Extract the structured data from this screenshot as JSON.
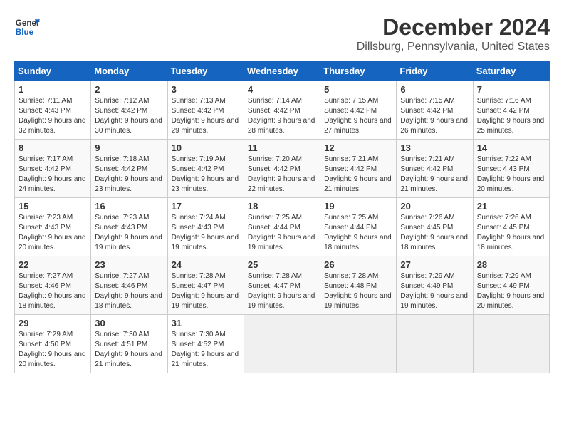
{
  "logo": {
    "line1": "General",
    "line2": "Blue"
  },
  "title": "December 2024",
  "subtitle": "Dillsburg, Pennsylvania, United States",
  "headers": [
    "Sunday",
    "Monday",
    "Tuesday",
    "Wednesday",
    "Thursday",
    "Friday",
    "Saturday"
  ],
  "weeks": [
    [
      {
        "day": "1",
        "sunrise": "7:11 AM",
        "sunset": "4:43 PM",
        "daylight": "9 hours and 32 minutes."
      },
      {
        "day": "2",
        "sunrise": "7:12 AM",
        "sunset": "4:42 PM",
        "daylight": "9 hours and 30 minutes."
      },
      {
        "day": "3",
        "sunrise": "7:13 AM",
        "sunset": "4:42 PM",
        "daylight": "9 hours and 29 minutes."
      },
      {
        "day": "4",
        "sunrise": "7:14 AM",
        "sunset": "4:42 PM",
        "daylight": "9 hours and 28 minutes."
      },
      {
        "day": "5",
        "sunrise": "7:15 AM",
        "sunset": "4:42 PM",
        "daylight": "9 hours and 27 minutes."
      },
      {
        "day": "6",
        "sunrise": "7:15 AM",
        "sunset": "4:42 PM",
        "daylight": "9 hours and 26 minutes."
      },
      {
        "day": "7",
        "sunrise": "7:16 AM",
        "sunset": "4:42 PM",
        "daylight": "9 hours and 25 minutes."
      }
    ],
    [
      {
        "day": "8",
        "sunrise": "7:17 AM",
        "sunset": "4:42 PM",
        "daylight": "9 hours and 24 minutes."
      },
      {
        "day": "9",
        "sunrise": "7:18 AM",
        "sunset": "4:42 PM",
        "daylight": "9 hours and 23 minutes."
      },
      {
        "day": "10",
        "sunrise": "7:19 AM",
        "sunset": "4:42 PM",
        "daylight": "9 hours and 23 minutes."
      },
      {
        "day": "11",
        "sunrise": "7:20 AM",
        "sunset": "4:42 PM",
        "daylight": "9 hours and 22 minutes."
      },
      {
        "day": "12",
        "sunrise": "7:21 AM",
        "sunset": "4:42 PM",
        "daylight": "9 hours and 21 minutes."
      },
      {
        "day": "13",
        "sunrise": "7:21 AM",
        "sunset": "4:42 PM",
        "daylight": "9 hours and 21 minutes."
      },
      {
        "day": "14",
        "sunrise": "7:22 AM",
        "sunset": "4:43 PM",
        "daylight": "9 hours and 20 minutes."
      }
    ],
    [
      {
        "day": "15",
        "sunrise": "7:23 AM",
        "sunset": "4:43 PM",
        "daylight": "9 hours and 20 minutes."
      },
      {
        "day": "16",
        "sunrise": "7:23 AM",
        "sunset": "4:43 PM",
        "daylight": "9 hours and 19 minutes."
      },
      {
        "day": "17",
        "sunrise": "7:24 AM",
        "sunset": "4:43 PM",
        "daylight": "9 hours and 19 minutes."
      },
      {
        "day": "18",
        "sunrise": "7:25 AM",
        "sunset": "4:44 PM",
        "daylight": "9 hours and 19 minutes."
      },
      {
        "day": "19",
        "sunrise": "7:25 AM",
        "sunset": "4:44 PM",
        "daylight": "9 hours and 18 minutes."
      },
      {
        "day": "20",
        "sunrise": "7:26 AM",
        "sunset": "4:45 PM",
        "daylight": "9 hours and 18 minutes."
      },
      {
        "day": "21",
        "sunrise": "7:26 AM",
        "sunset": "4:45 PM",
        "daylight": "9 hours and 18 minutes."
      }
    ],
    [
      {
        "day": "22",
        "sunrise": "7:27 AM",
        "sunset": "4:46 PM",
        "daylight": "9 hours and 18 minutes."
      },
      {
        "day": "23",
        "sunrise": "7:27 AM",
        "sunset": "4:46 PM",
        "daylight": "9 hours and 18 minutes."
      },
      {
        "day": "24",
        "sunrise": "7:28 AM",
        "sunset": "4:47 PM",
        "daylight": "9 hours and 19 minutes."
      },
      {
        "day": "25",
        "sunrise": "7:28 AM",
        "sunset": "4:47 PM",
        "daylight": "9 hours and 19 minutes."
      },
      {
        "day": "26",
        "sunrise": "7:28 AM",
        "sunset": "4:48 PM",
        "daylight": "9 hours and 19 minutes."
      },
      {
        "day": "27",
        "sunrise": "7:29 AM",
        "sunset": "4:49 PM",
        "daylight": "9 hours and 19 minutes."
      },
      {
        "day": "28",
        "sunrise": "7:29 AM",
        "sunset": "4:49 PM",
        "daylight": "9 hours and 20 minutes."
      }
    ],
    [
      {
        "day": "29",
        "sunrise": "7:29 AM",
        "sunset": "4:50 PM",
        "daylight": "9 hours and 20 minutes."
      },
      {
        "day": "30",
        "sunrise": "7:30 AM",
        "sunset": "4:51 PM",
        "daylight": "9 hours and 21 minutes."
      },
      {
        "day": "31",
        "sunrise": "7:30 AM",
        "sunset": "4:52 PM",
        "daylight": "9 hours and 21 minutes."
      },
      null,
      null,
      null,
      null
    ]
  ]
}
